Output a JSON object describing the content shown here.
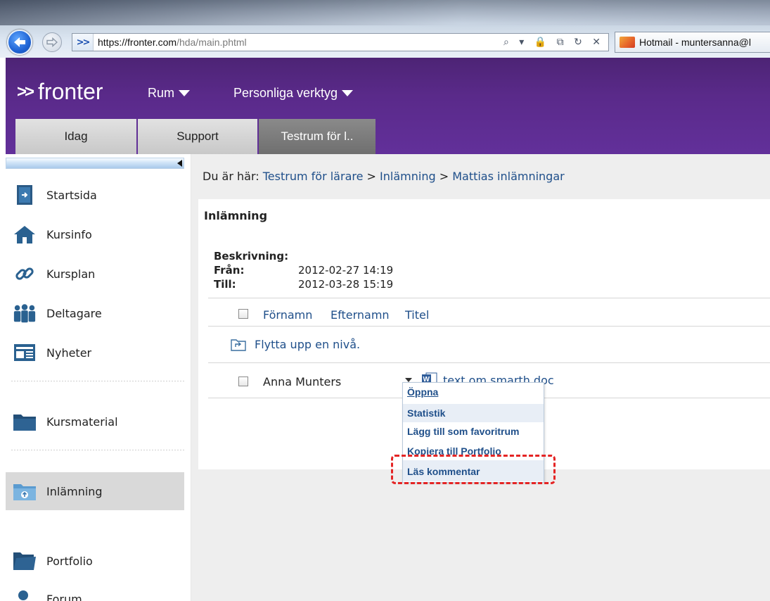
{
  "browser": {
    "url_host": "https://fronter.com",
    "url_path": "/hda/main.phtml",
    "address_tools": "⌕ ▾ 🔒 ⧉ ↻ ✕",
    "tab_label": "Hotmail - muntersanna@l",
    "icons": {
      "back": "back-arrow-icon",
      "forward": "forward-arrow-icon",
      "site": "double-chevron-icon",
      "tab": "hotmail-envelope-icon"
    }
  },
  "header": {
    "logo": "fronter",
    "logo_chevrons": ">>",
    "menus": [
      {
        "label": "Rum"
      },
      {
        "label": "Personliga verktyg"
      }
    ],
    "tabs": [
      {
        "label": "Idag"
      },
      {
        "label": "Support"
      },
      {
        "label": "Testrum för l.."
      }
    ],
    "colors": {
      "background": "#5a2a8a",
      "active_tab": "#777777"
    }
  },
  "sidebar": {
    "items": [
      {
        "label": "Startsida",
        "icon": "door-exit-icon"
      },
      {
        "label": "Kursinfo",
        "icon": "house-icon"
      },
      {
        "label": "Kursplan",
        "icon": "chain-link-icon"
      },
      {
        "label": "Deltagare",
        "icon": "people-group-icon"
      },
      {
        "label": "Nyheter",
        "icon": "newspaper-icon"
      },
      {
        "label": "Kursmaterial",
        "icon": "folder-icon"
      },
      {
        "label": "Inlämning",
        "icon": "upload-folder-icon",
        "active": true
      },
      {
        "label": "Portfolio",
        "icon": "open-folder-icon"
      },
      {
        "label": "Forum",
        "icon": "person-icon"
      }
    ]
  },
  "main": {
    "breadcrumb": {
      "prefix": "Du är här:",
      "parts": [
        "Testrum för lärare",
        "Inlämning",
        "Mattias inlämningar"
      ],
      "separator": ">"
    },
    "title": "Inlämning",
    "description_label": "Beskrivning:",
    "from_label": "Från:",
    "from_value": "2012-02-27 14:19",
    "to_label": "Till:",
    "to_value": "2012-03-28 15:19",
    "columns": [
      "Förnamn",
      "Efternamn",
      "Titel"
    ],
    "up_level": "Flytta upp en nivå.",
    "rows": [
      {
        "name": "Anna Munters",
        "file": "text om smarth.doc"
      }
    ]
  },
  "context_menu": {
    "items": [
      "Öppna",
      "Statistik",
      "Lägg till som favoritrum",
      "Kopiera till Portfolio",
      "Läs kommentar"
    ]
  },
  "highlight": {
    "color": "#e42424",
    "target": "Läs kommentar"
  }
}
